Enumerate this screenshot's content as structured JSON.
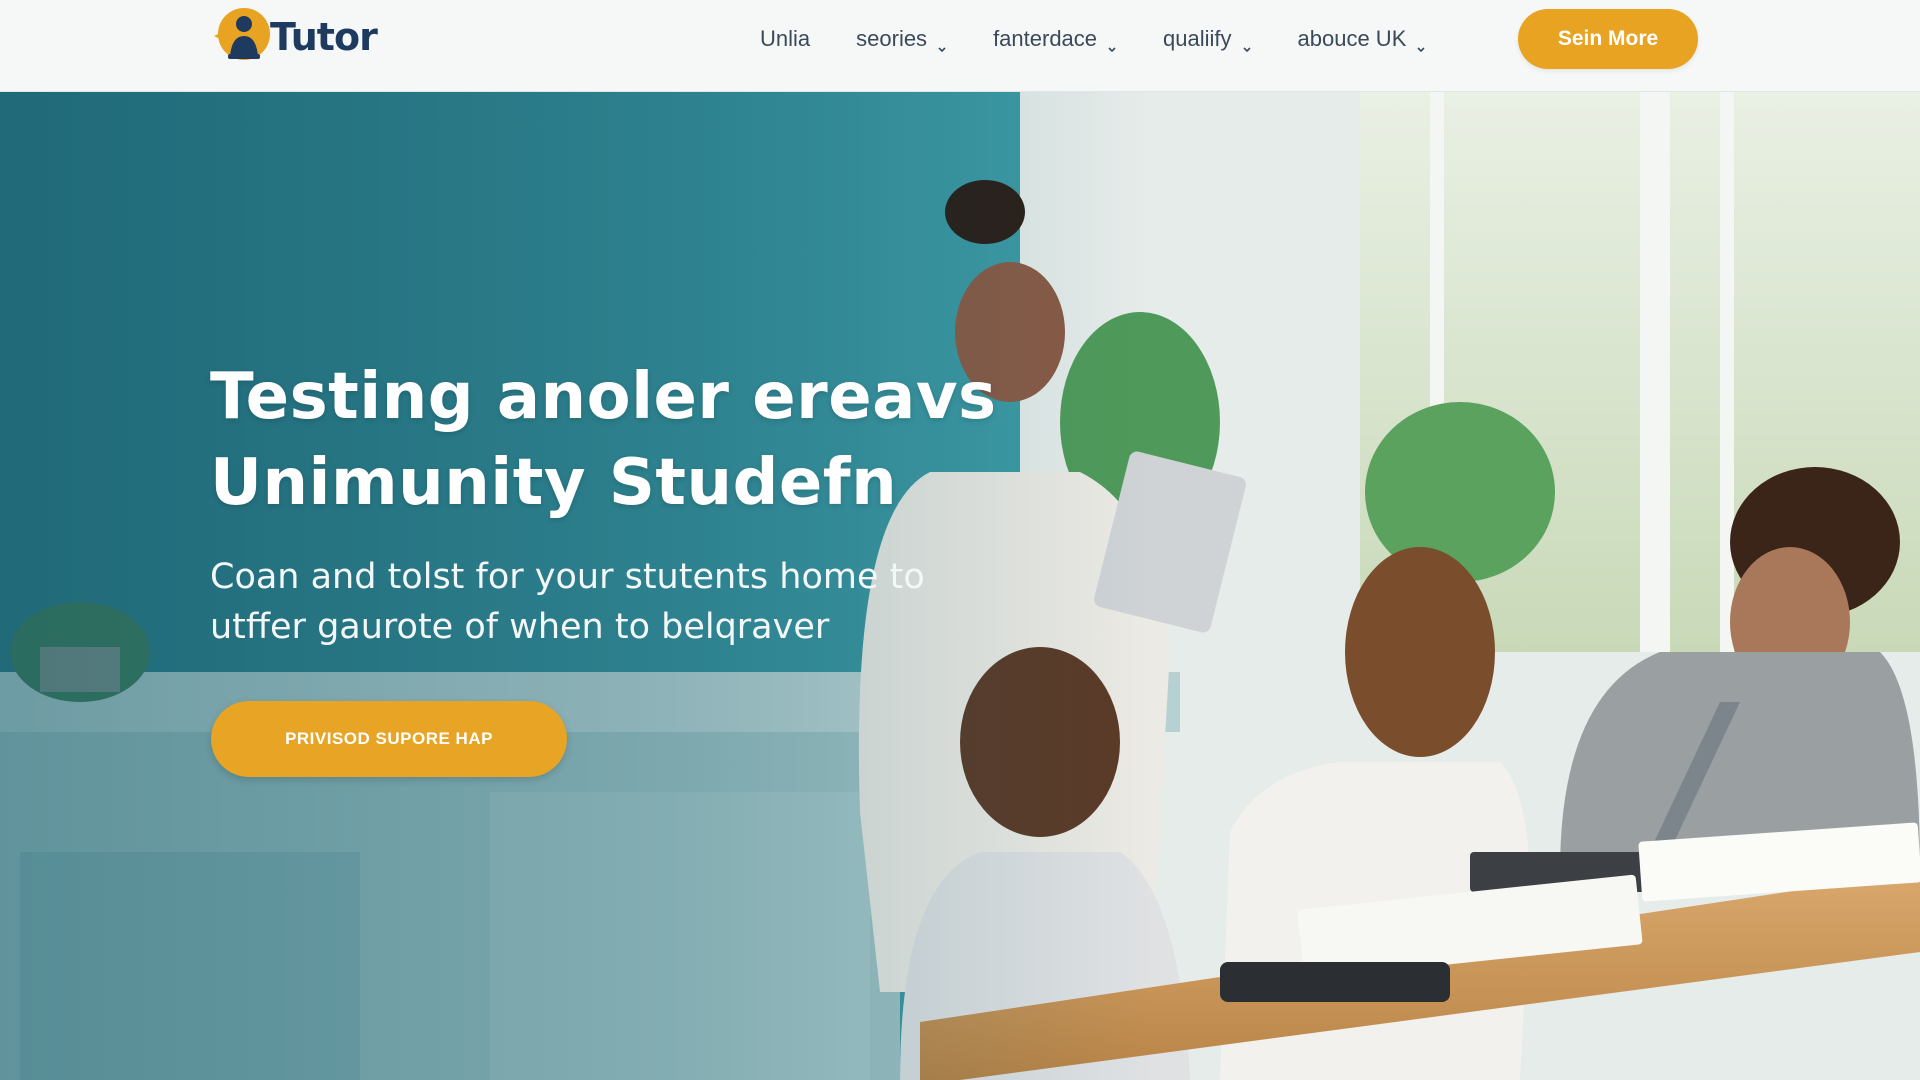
{
  "brand": {
    "name": "Tutor"
  },
  "nav": {
    "items": [
      {
        "label": "Unlia",
        "has_dropdown": false
      },
      {
        "label": "seories",
        "has_dropdown": true
      },
      {
        "label": "fanterdace",
        "has_dropdown": true
      },
      {
        "label": "qualiify",
        "has_dropdown": true
      },
      {
        "label": "abouce UK",
        "has_dropdown": true
      }
    ],
    "cta_label": "Sein More"
  },
  "hero": {
    "title_lines": [
      "Testing anoler ereavs",
      "Unimunity Studefn"
    ],
    "subtitle_lines": [
      "Coan and tolst for your stutents home to",
      "utffer gaurote of when to belqraver"
    ],
    "cta_label": "PRIVISOD SUPORE HAP"
  },
  "colors": {
    "accent": "#e7a321",
    "brand_text": "#1e3a5f",
    "header_bg": "#f6f7f7",
    "hero_wall": "#2f7f8f"
  },
  "icons": [
    "tutor-logo-icon",
    "chevron-down-icon"
  ]
}
